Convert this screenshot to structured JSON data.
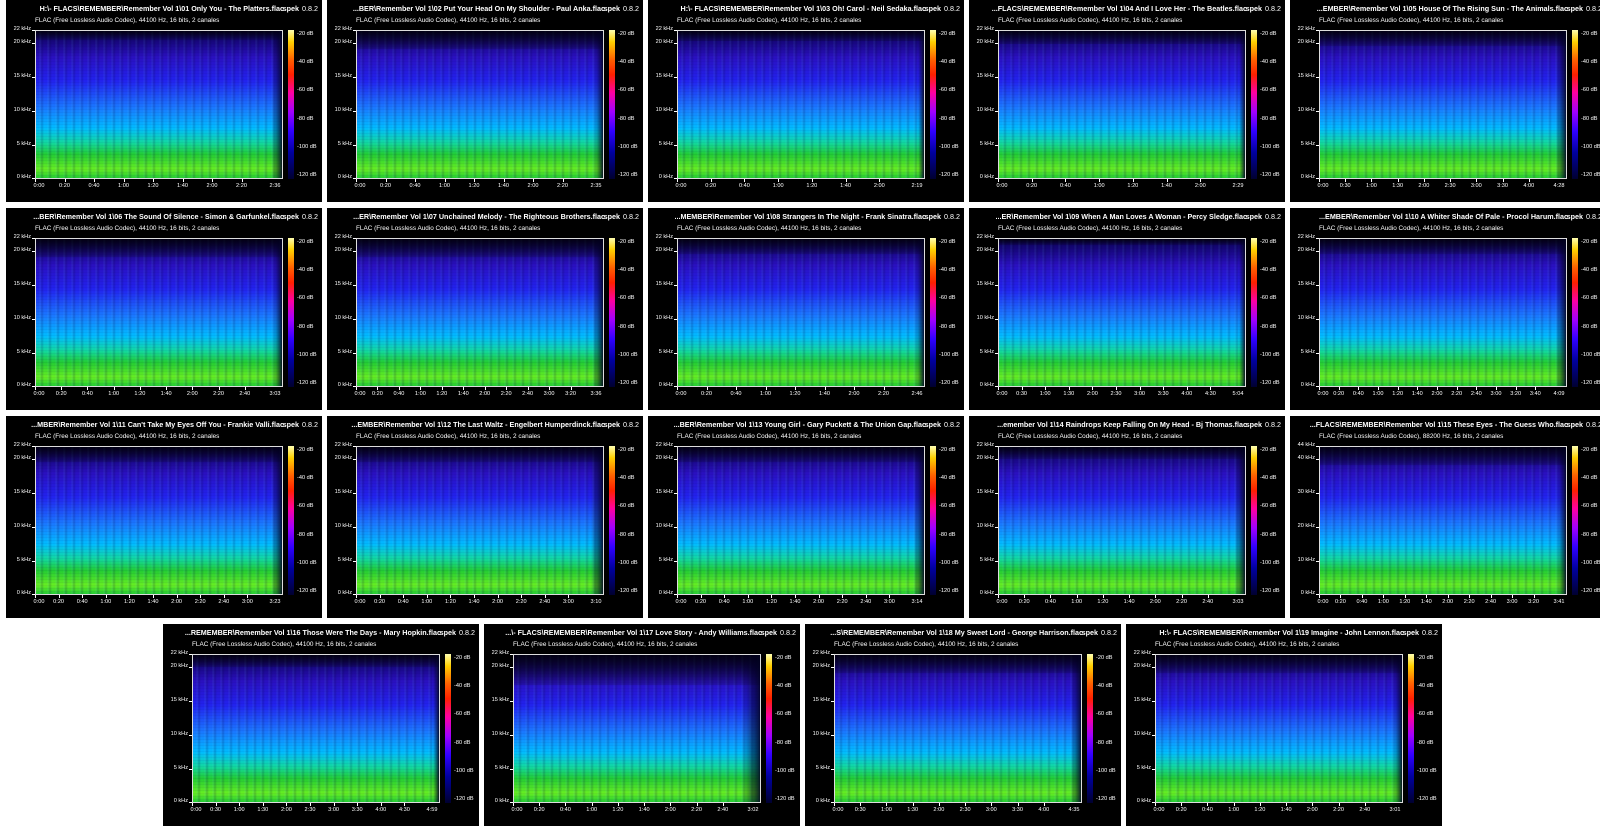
{
  "app": "spek",
  "version": "0.8.2",
  "colorbar_labels": [
    "-20 dB",
    "-40 dB",
    "-60 dB",
    "-80 dB",
    "-100 dB",
    "-120 dB"
  ],
  "colors": {
    "panel_bg": "#000000",
    "spectrum_low": "#22cc33",
    "spectrum_mid": "#00bbff",
    "spectrum_high": "#2222ee",
    "spectrum_top": "#0a0050"
  },
  "panels": [
    {
      "title": "H:\\- FLACS\\REMEMBER\\Remember Vol 1\\01 Only You - The Platters.flac",
      "info": "FLAC (Free Lossless Audio Codec), 44100 Hz, 16 bits, 2 canales",
      "yticks": [
        "22 kHz",
        "20 kHz",
        "15 kHz",
        "10 kHz",
        "5 kHz",
        "0 kHz"
      ],
      "xticks": [
        "0:00",
        "0:20",
        "0:40",
        "1:00",
        "1:20",
        "1:40",
        "2:00",
        "2:20"
      ],
      "duration": "2:36"
    },
    {
      "title": "...BER\\Remember Vol 1\\02 Put Your Head On My Shoulder - Paul Anka.flac",
      "info": "FLAC (Free Lossless Audio Codec), 44100 Hz, 16 bits, 2 canales",
      "yticks": [
        "22 kHz",
        "20 kHz",
        "15 kHz",
        "10 kHz",
        "5 kHz",
        "0 kHz"
      ],
      "xticks": [
        "0:00",
        "0:20",
        "0:40",
        "1:00",
        "1:20",
        "1:40",
        "2:00",
        "2:20"
      ],
      "duration": "2:35"
    },
    {
      "title": "H:\\- FLACS\\REMEMBER\\Remember Vol 1\\03 Oh! Carol - Neil Sedaka.flac",
      "info": "FLAC (Free Lossless Audio Codec), 44100 Hz, 16 bits, 2 canales",
      "yticks": [
        "22 kHz",
        "20 kHz",
        "15 kHz",
        "10 kHz",
        "5 kHz",
        "0 kHz"
      ],
      "xticks": [
        "0:00",
        "0:20",
        "0:40",
        "1:00",
        "1:20",
        "1:40",
        "2:00"
      ],
      "duration": "2:19"
    },
    {
      "title": "...FLACS\\REMEMBER\\Remember Vol 1\\04 And I Love Her - The Beatles.flac",
      "info": "FLAC (Free Lossless Audio Codec), 44100 Hz, 16 bits, 2 canales",
      "yticks": [
        "22 kHz",
        "20 kHz",
        "15 kHz",
        "10 kHz",
        "5 kHz",
        "0 kHz"
      ],
      "xticks": [
        "0:00",
        "0:20",
        "0:40",
        "1:00",
        "1:20",
        "1:40",
        "2:00"
      ],
      "duration": "2:29"
    },
    {
      "title": "...EMBER\\Remember Vol 1\\05 House Of The Rising Sun - The Animals.flac",
      "info": "FLAC (Free Lossless Audio Codec), 44100 Hz, 16 bits, 2 canales",
      "yticks": [
        "22 kHz",
        "20 kHz",
        "15 kHz",
        "10 kHz",
        "5 kHz",
        "0 kHz"
      ],
      "xticks": [
        "0:00",
        "0:30",
        "1:00",
        "1:30",
        "2:00",
        "2:30",
        "3:00",
        "3:30",
        "4:00"
      ],
      "duration": "4:28"
    },
    {
      "title": "...BER\\Remember Vol 1\\06 The Sound Of Silence - Simon & Garfunkel.flac",
      "info": "FLAC (Free Lossless Audio Codec), 44100 Hz, 16 bits, 2 canales",
      "yticks": [
        "22 kHz",
        "20 kHz",
        "15 kHz",
        "10 kHz",
        "5 kHz",
        "0 kHz"
      ],
      "xticks": [
        "0:00",
        "0:20",
        "0:40",
        "1:00",
        "1:20",
        "1:40",
        "2:00",
        "2:20",
        "2:40"
      ],
      "duration": "3:03"
    },
    {
      "title": "...ER\\Remember Vol 1\\07 Unchained Melody - The Righteous Brothers.flac",
      "info": "FLAC (Free Lossless Audio Codec), 44100 Hz, 16 bits, 2 canales",
      "yticks": [
        "22 kHz",
        "20 kHz",
        "15 kHz",
        "10 kHz",
        "5 kHz",
        "0 kHz"
      ],
      "xticks": [
        "0:00",
        "0:20",
        "0:40",
        "1:00",
        "1:20",
        "1:40",
        "2:00",
        "2:20",
        "2:40",
        "3:00",
        "3:20"
      ],
      "duration": "3:36"
    },
    {
      "title": "...MEMBER\\Remember Vol 1\\08 Strangers In The Night - Frank Sinatra.flac",
      "info": "FLAC (Free Lossless Audio Codec), 44100 Hz, 16 bits, 2 canales",
      "yticks": [
        "22 kHz",
        "20 kHz",
        "15 kHz",
        "10 kHz",
        "5 kHz",
        "0 kHz"
      ],
      "xticks": [
        "0:00",
        "0:20",
        "0:40",
        "1:00",
        "1:20",
        "1:40",
        "2:00",
        "2:20"
      ],
      "duration": "2:46"
    },
    {
      "title": "...ER\\Remember Vol 1\\09 When A Man Loves A Woman - Percy Sledge.flac",
      "info": "FLAC (Free Lossless Audio Codec), 44100 Hz, 16 bits, 2 canales",
      "yticks": [
        "22 kHz",
        "20 kHz",
        "15 kHz",
        "10 kHz",
        "5 kHz",
        "0 kHz"
      ],
      "xticks": [
        "0:00",
        "0:30",
        "1:00",
        "1:30",
        "2:00",
        "2:30",
        "3:00",
        "3:30",
        "4:00",
        "4:30"
      ],
      "duration": "5:04"
    },
    {
      "title": "...EMBER\\Remember Vol 1\\10 A Whiter Shade Of Pale - Procol Harum.flac",
      "info": "FLAC (Free Lossless Audio Codec), 44100 Hz, 16 bits, 2 canales",
      "yticks": [
        "22 kHz",
        "20 kHz",
        "15 kHz",
        "10 kHz",
        "5 kHz",
        "0 kHz"
      ],
      "xticks": [
        "0:00",
        "0:20",
        "0:40",
        "1:00",
        "1:20",
        "1:40",
        "2:00",
        "2:20",
        "2:40",
        "3:00",
        "3:20",
        "3:40"
      ],
      "duration": "4:09"
    },
    {
      "title": "...MBER\\Remember Vol 1\\11 Can't Take My Eyes Off You - Frankie Valli.flac",
      "info": "FLAC (Free Lossless Audio Codec), 44100 Hz, 16 bits, 2 canales",
      "yticks": [
        "22 kHz",
        "20 kHz",
        "15 kHz",
        "10 kHz",
        "5 kHz",
        "0 kHz"
      ],
      "xticks": [
        "0:00",
        "0:20",
        "0:40",
        "1:00",
        "1:20",
        "1:40",
        "2:00",
        "2:20",
        "2:40",
        "3:00"
      ],
      "duration": "3:23"
    },
    {
      "title": "...EMBER\\Remember Vol 1\\12 The Last Waltz - Engelbert Humperdinck.flac",
      "info": "FLAC (Free Lossless Audio Codec), 44100 Hz, 16 bits, 2 canales",
      "yticks": [
        "22 kHz",
        "20 kHz",
        "15 kHz",
        "10 kHz",
        "5 kHz",
        "0 kHz"
      ],
      "xticks": [
        "0:00",
        "0:20",
        "0:40",
        "1:00",
        "1:20",
        "1:40",
        "2:00",
        "2:20",
        "2:40",
        "3:00"
      ],
      "duration": "3:10"
    },
    {
      "title": "...BER\\Remember Vol 1\\13 Young Girl - Gary Puckett & The Union Gap.flac",
      "info": "FLAC (Free Lossless Audio Codec), 44100 Hz, 16 bits, 2 canales",
      "yticks": [
        "22 kHz",
        "20 kHz",
        "15 kHz",
        "10 kHz",
        "5 kHz",
        "0 kHz"
      ],
      "xticks": [
        "0:00",
        "0:20",
        "0:40",
        "1:00",
        "1:20",
        "1:40",
        "2:00",
        "2:20",
        "2:40",
        "3:00"
      ],
      "duration": "3:14"
    },
    {
      "title": "...emember Vol 1\\14 Raindrops Keep Falling On My Head - Bj Thomas.flac",
      "info": "FLAC (Free Lossless Audio Codec), 44100 Hz, 16 bits, 2 canales",
      "yticks": [
        "22 kHz",
        "20 kHz",
        "15 kHz",
        "10 kHz",
        "5 kHz",
        "0 kHz"
      ],
      "xticks": [
        "0:00",
        "0:20",
        "0:40",
        "1:00",
        "1:20",
        "1:40",
        "2:00",
        "2:20",
        "2:40"
      ],
      "duration": "3:03"
    },
    {
      "title": "...FLACS\\REMEMBER\\Remember Vol 1\\15 These Eyes - The Guess Who.flac",
      "info": "FLAC (Free Lossless Audio Codec), 88200 Hz, 16 bits, 2 canales",
      "yticks": [
        "44 kHz",
        "40 kHz",
        "30 kHz",
        "20 kHz",
        "10 kHz",
        "0 kHz"
      ],
      "xticks": [
        "0:00",
        "0:20",
        "0:40",
        "1:00",
        "1:20",
        "1:40",
        "2:00",
        "2:20",
        "2:40",
        "3:00",
        "3:20"
      ],
      "duration": "3:41"
    },
    {
      "title": "...REMEMBER\\Remember Vol 1\\16 Those Were The Days - Mary Hopkin.flac",
      "info": "FLAC (Free Lossless Audio Codec), 44100 Hz, 16 bits, 2 canales",
      "yticks": [
        "22 kHz",
        "20 kHz",
        "15 kHz",
        "10 kHz",
        "5 kHz",
        "0 kHz"
      ],
      "xticks": [
        "0:00",
        "0:30",
        "1:00",
        "1:30",
        "2:00",
        "2:30",
        "3:00",
        "3:30",
        "4:00",
        "4:30"
      ],
      "duration": "4:59"
    },
    {
      "title": "...\\- FLACS\\REMEMBER\\Remember Vol 1\\17 Love Story - Andy Williams.flac",
      "info": "FLAC (Free Lossless Audio Codec), 44100 Hz, 16 bits, 2 canales",
      "yticks": [
        "22 kHz",
        "20 kHz",
        "15 kHz",
        "10 kHz",
        "5 kHz",
        "0 kHz"
      ],
      "xticks": [
        "0:00",
        "0:20",
        "0:40",
        "1:00",
        "1:20",
        "1:40",
        "2:00",
        "2:20",
        "2:40"
      ],
      "duration": "3:02"
    },
    {
      "title": "...S\\REMEMBER\\Remember Vol 1\\18 My Sweet Lord - George Harrison.flac",
      "info": "FLAC (Free Lossless Audio Codec), 44100 Hz, 16 bits, 2 canales",
      "yticks": [
        "22 kHz",
        "20 kHz",
        "15 kHz",
        "10 kHz",
        "5 kHz",
        "0 kHz"
      ],
      "xticks": [
        "0:00",
        "0:30",
        "1:00",
        "1:30",
        "2:00",
        "2:30",
        "3:00",
        "3:30",
        "4:00"
      ],
      "duration": "4:35"
    },
    {
      "title": "H:\\- FLACS\\REMEMBER\\Remember Vol 1\\19 Imagine - John Lennon.flac",
      "info": "FLAC (Free Lossless Audio Codec), 44100 Hz, 16 bits, 2 canales",
      "yticks": [
        "22 kHz",
        "20 kHz",
        "15 kHz",
        "10 kHz",
        "5 kHz",
        "0 kHz"
      ],
      "xticks": [
        "0:00",
        "0:20",
        "0:40",
        "1:00",
        "1:20",
        "1:40",
        "2:00",
        "2:20",
        "2:40"
      ],
      "duration": "3:01"
    }
  ]
}
